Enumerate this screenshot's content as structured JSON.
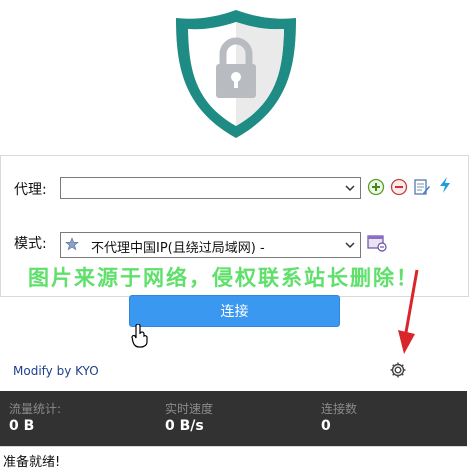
{
  "proxy": {
    "label": "代理:",
    "value": ""
  },
  "mode": {
    "label": "模式:",
    "selected": "不代理中国IP(且绕过局域网) -"
  },
  "icons": {
    "logo": "shield-lock-icon",
    "add": "add-icon",
    "remove": "remove-icon",
    "edit": "edit-icon",
    "speedtest": "lightning-icon",
    "mode_edit": "mode-edit-icon",
    "settings": "gear-icon",
    "mode_item": "star-icon"
  },
  "watermark": "图片来源于网络，侵权联系站长删除！",
  "connect_button": "连接",
  "modify_link": "Modify by KYO",
  "stats": {
    "traffic": {
      "label": "流量统计:",
      "value": "0 B"
    },
    "speed": {
      "label": "实时速度",
      "value": "0 B/s"
    },
    "connections": {
      "label": "连接数",
      "value": "0"
    }
  },
  "status": "准备就绪!",
  "colors": {
    "accent": "#3a98f1",
    "teal": "#1e8c84",
    "stats_bg": "#323232",
    "watermark": "#5ee06a"
  }
}
